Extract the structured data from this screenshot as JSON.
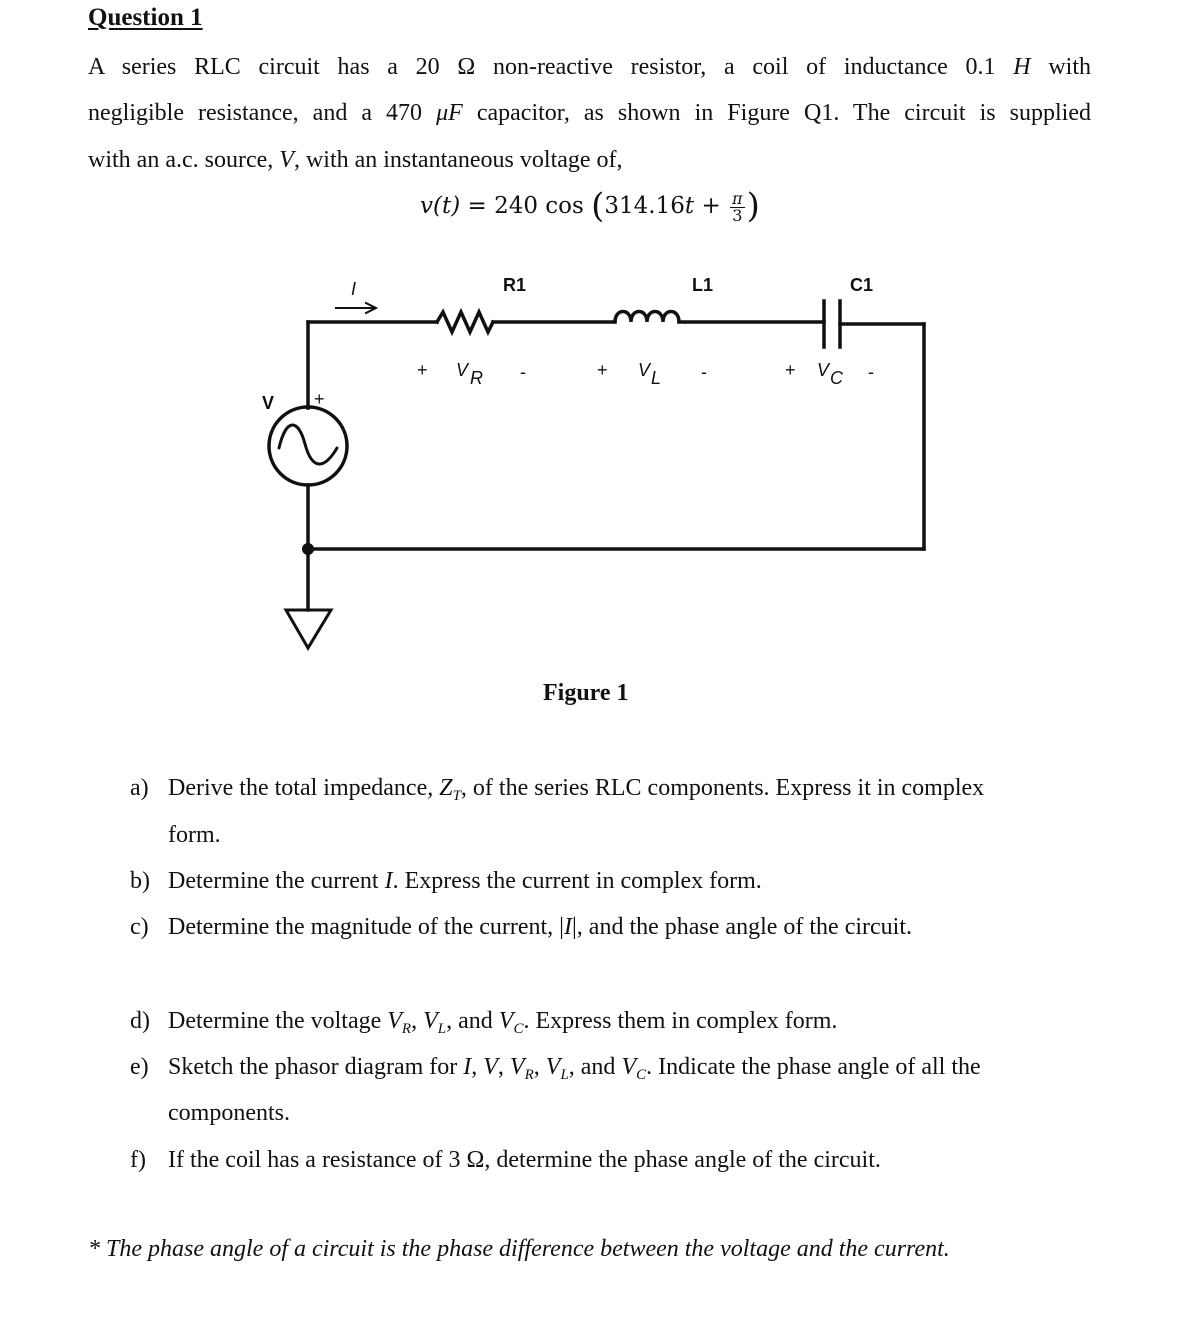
{
  "question": {
    "title": "Question 1",
    "intro": {
      "line1": {
        "pre": "A series RLC circuit has a 20 Ω non-reactive resistor, a coil of inductance 0.1 ",
        "unit_H": "H",
        "post": " with"
      },
      "line2": {
        "pre": "negligible resistance, and a 470 ",
        "unit_uF": "μF",
        "post": " capacitor, as shown in Figure Q1. The circuit is supplied"
      },
      "line3": {
        "pre": "with an a.c. source, ",
        "var_V": "V",
        "post": ", with an instantaneous voltage of,"
      }
    },
    "equation": {
      "lhs": "v(t)",
      "equals": " = 240 cos",
      "arg": "314.16",
      "t": "t",
      "plus": " + ",
      "frac_num": "π",
      "frac_den": "3"
    }
  },
  "figure": {
    "caption": "Figure 1",
    "labels": {
      "current": "I",
      "source": "V",
      "source_plus": "+",
      "r1": "R1",
      "l1": "L1",
      "c1": "C1",
      "vr_plus": "+",
      "vr": "V",
      "vr_sub": "R",
      "vr_minus": "-",
      "vl_plus": "+",
      "vl": "V",
      "vl_sub": "L",
      "vl_minus": "-",
      "vc_plus": "+",
      "vc": "V",
      "vc_sub": "C",
      "vc_minus": "-"
    }
  },
  "parts": [
    {
      "label": "a)",
      "text_pre": "Derive the total impedance, ",
      "sym": "Z",
      "sub": "T",
      "text_post": ", of the series RLC components. Express it in complex",
      "cont": "form."
    },
    {
      "label": "b)",
      "text_pre": "Determine the current ",
      "sym": "I",
      "text_post": ". Express the current in complex form."
    },
    {
      "label": "c)",
      "text_pre": "Determine the magnitude of the current, |",
      "sym": "I",
      "text_post": "|, and the phase angle of the circuit."
    },
    {
      "label": "d)",
      "text_pre": "Determine the voltage ",
      "s1": "V",
      "s1sub": "R",
      "s2": "V",
      "s2sub": "L",
      "s3": "V",
      "s3sub": "C",
      "text_post": ". Express them in complex form."
    },
    {
      "label": "e)",
      "text_pre": "Sketch the phasor diagram for ",
      "i": "I",
      "v": "V",
      "s1": "V",
      "s1sub": "R",
      "s2": "V",
      "s2sub": "L",
      "s3": "V",
      "s3sub": "C",
      "text_post": ". Indicate the phase angle of all the",
      "cont": "components."
    },
    {
      "label": "f)",
      "text_pre": "If the coil has a resistance of 3 Ω, determine the phase angle of the circuit."
    }
  ],
  "note": "* The phase angle of a circuit is the phase difference between the voltage and the current."
}
